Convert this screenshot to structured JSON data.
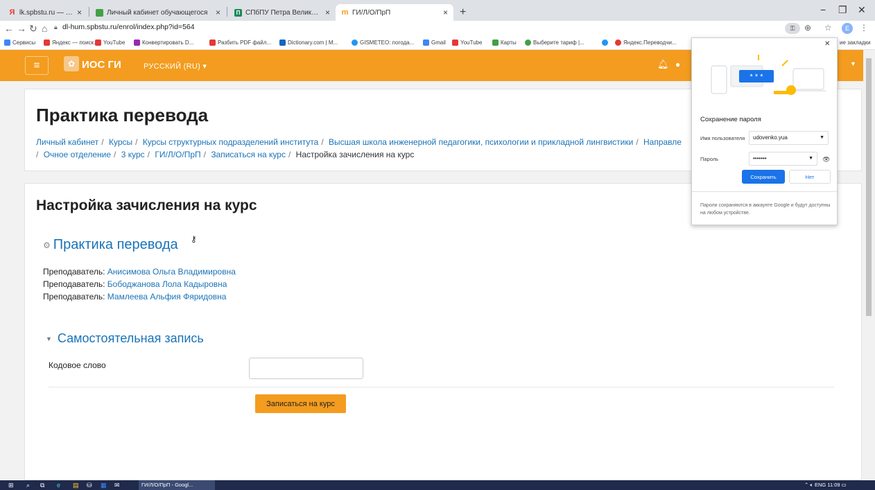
{
  "tabs": [
    {
      "label": "lk.spbstu.ru — Яндекс: нашлось",
      "icon": "yandex-icon",
      "color": "#e53935",
      "glyph": "Я"
    },
    {
      "label": "Личный кабинет обучающегося",
      "icon": "green-square-icon",
      "color": "#43a047",
      "glyph": ""
    },
    {
      "label": "СПбПУ Петра Великого",
      "icon": "polytech-icon",
      "color": "#1b8a5a",
      "glyph": "П"
    },
    {
      "label": "ГИ/Л/О/ПрП",
      "icon": "moodle-icon",
      "color": "#f39c1f",
      "glyph": "m"
    }
  ],
  "window": {
    "minimize": "−",
    "maximize": "❐",
    "close": "✕"
  },
  "address": {
    "url": "dl-hum.spbstu.ru/enrol/index.php?id=564",
    "profile_initial": "E"
  },
  "bookmarks": [
    {
      "label": "Сервисы",
      "color": "#4285f4"
    },
    {
      "label": "Яндекс — поиск...",
      "color": "#e53935"
    },
    {
      "label": "YouTube",
      "color": "#e53935"
    },
    {
      "label": "Конвертировать D...",
      "color": "#9c27b0"
    },
    {
      "label": "Разбить PDF файл...",
      "color": "#e53935"
    },
    {
      "label": "Dictionary.com | M...",
      "color": "#1565c0"
    },
    {
      "label": "GISMETEO: погода...",
      "color": "#2196f3"
    },
    {
      "label": "Gmail",
      "color": "#4285f4"
    },
    {
      "label": "YouTube",
      "color": "#e53935"
    },
    {
      "label": "Карты",
      "color": "#43a047"
    },
    {
      "label": "Выберите тариф |...",
      "color": "#43a047"
    },
    {
      "label": "",
      "color": "#2196f3"
    },
    {
      "label": "Яндекс.Переводчи...",
      "color": "#e53935"
    }
  ],
  "bookmarks_more": "ие закладки",
  "header": {
    "site_name": "ИОС ГИ",
    "language": "РУССКИЙ (RU) ▾"
  },
  "page": {
    "title": "Практика перевода",
    "breadcrumbs_line1": [
      "Личный кабинет",
      "Курсы",
      "Курсы структурных подразделений института",
      "Высшая школа инженерной педагогики, психологии и прикладной лингвистики",
      "Направле"
    ],
    "breadcrumbs_line2": [
      "Очное отделение",
      "3 курс",
      "ГИ/Л/О/ПрП",
      "Записаться на курс"
    ],
    "breadcrumb_current": "Настройка зачисления на курс"
  },
  "enrol": {
    "heading": "Настройка зачисления на курс",
    "course_name": "Практика перевода",
    "teacher_label": "Преподаватель: ",
    "teachers": [
      "Анисимова Ольга Владимировна",
      "Бободжанова Лола Кадыровна",
      "Мамлеева Альфия Фяридовна"
    ],
    "self_enrol_heading": "Самостоятельная запись",
    "keyword_label": "Кодовое слово",
    "keyword_value": "",
    "submit_label": "Записаться на курс"
  },
  "password_popup": {
    "title": "Сохранение пароля",
    "username_label": "Имя пользователя",
    "username_value": "udovenko.yua",
    "password_label": "Пароль",
    "password_value": "•••••••",
    "art_text": "* * *",
    "save_label": "Сохранить",
    "no_label": "Нет",
    "footer": "Пароли сохраняются в аккаунте Google и будут доступны на любом устройстве."
  },
  "taskbar": {
    "app_label": "ГИ/Л/О/ПрП - Googl...",
    "lang": "ENG",
    "time": "11:09"
  },
  "colors": {
    "accent": "#f39c1f",
    "link": "#1a73b8",
    "google_blue": "#1a73e8"
  }
}
